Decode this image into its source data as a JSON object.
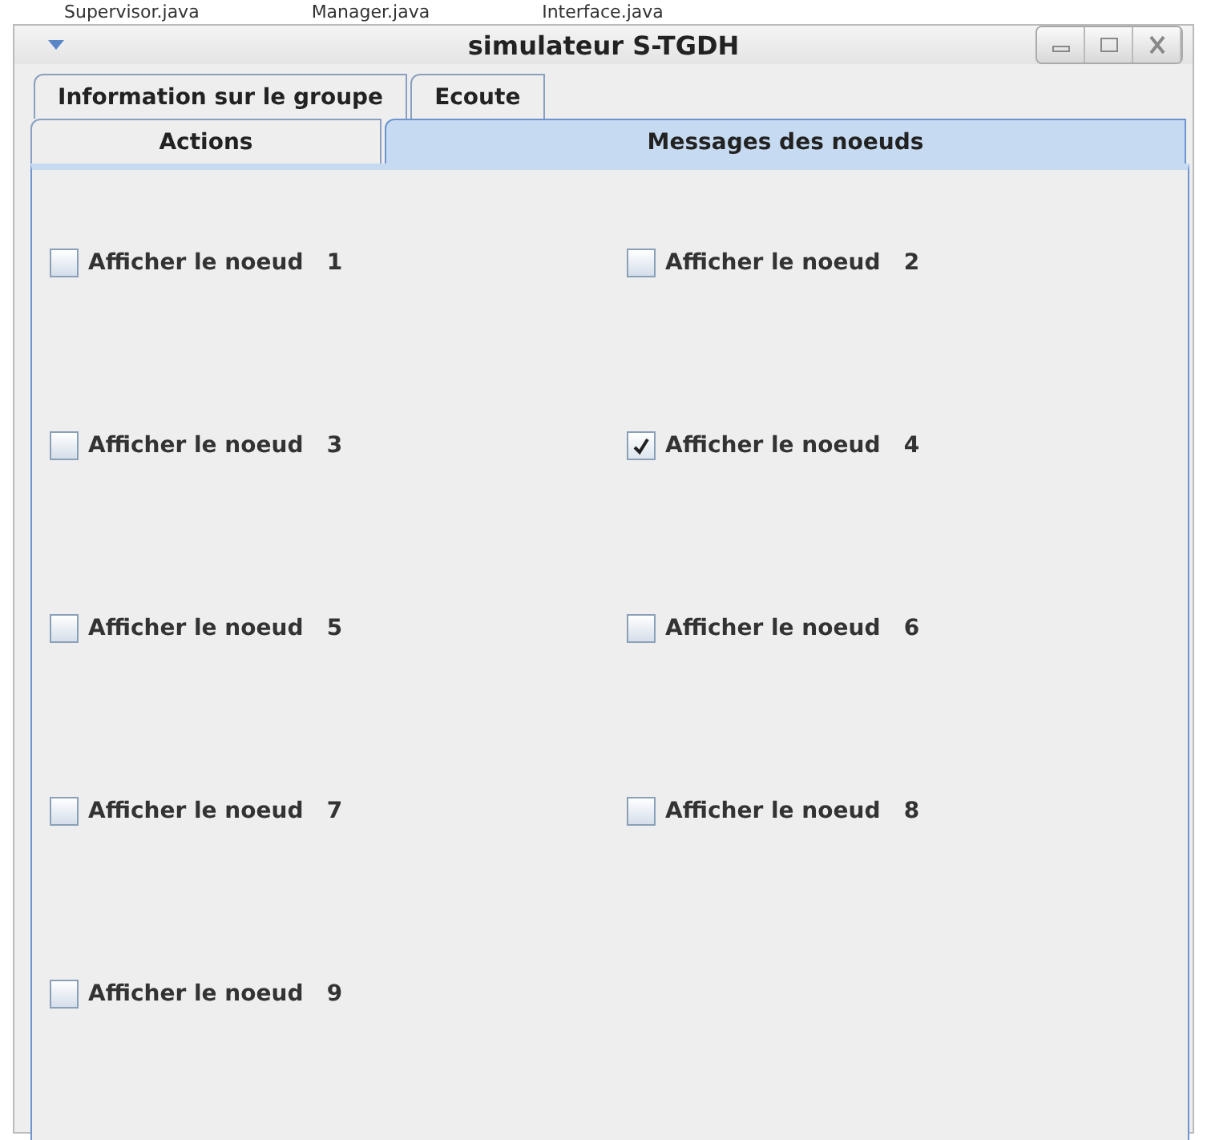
{
  "background_tabs": [
    {
      "label": "Supervisor.java"
    },
    {
      "label": "Manager.java"
    },
    {
      "label": "Interface.java"
    }
  ],
  "window": {
    "title": "simulateur S-TGDH"
  },
  "tab_rows": [
    [
      {
        "label": "Information sur le groupe",
        "selected": false
      },
      {
        "label": "Ecoute",
        "selected": false
      }
    ],
    [
      {
        "label": "Actions",
        "selected": false
      },
      {
        "label": "Messages des noeuds",
        "selected": true
      }
    ]
  ],
  "checkboxes": [
    {
      "label": "Afficher le noeud   1",
      "checked": false
    },
    {
      "label": "Afficher le noeud   2",
      "checked": false
    },
    {
      "label": "Afficher le noeud   3",
      "checked": false
    },
    {
      "label": "Afficher le noeud   4",
      "checked": true
    },
    {
      "label": "Afficher le noeud   5",
      "checked": false
    },
    {
      "label": "Afficher le noeud   6",
      "checked": false
    },
    {
      "label": "Afficher le noeud   7",
      "checked": false
    },
    {
      "label": "Afficher le noeud   8",
      "checked": false
    },
    {
      "label": "Afficher le noeud   9",
      "checked": false
    }
  ]
}
